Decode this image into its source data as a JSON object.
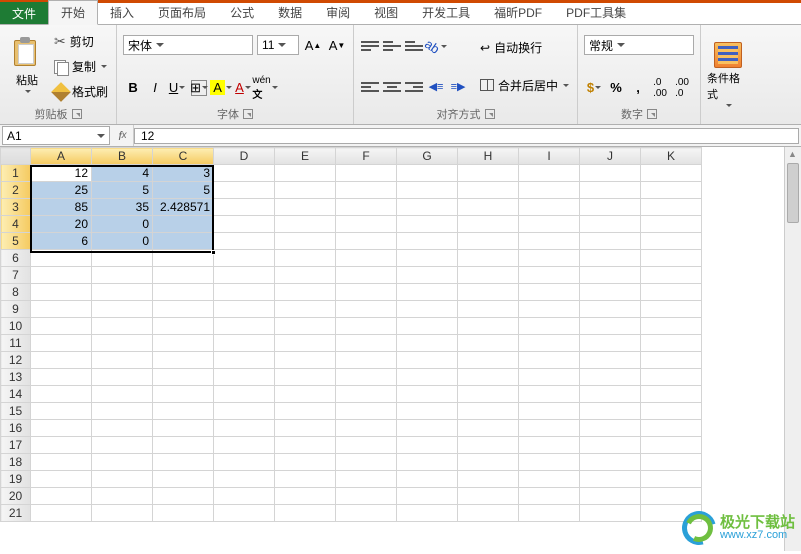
{
  "tabs": {
    "file": "文件",
    "home": "开始",
    "insert": "插入",
    "page_layout": "页面布局",
    "formulas": "公式",
    "data": "数据",
    "review": "审阅",
    "view": "视图",
    "dev": "开发工具",
    "foxit": "福昕PDF",
    "pdftools": "PDF工具集"
  },
  "ribbon": {
    "clipboard": {
      "paste": "粘贴",
      "cut": "剪切",
      "copy": "复制",
      "brush": "格式刷",
      "label": "剪贴板"
    },
    "font": {
      "name": "宋体",
      "size": "11",
      "label": "字体"
    },
    "align": {
      "wrap": "自动换行",
      "merge": "合并后居中",
      "label": "对齐方式"
    },
    "number": {
      "format": "常规",
      "label": "数字"
    },
    "cond": {
      "label": "条件格式"
    }
  },
  "namebox": "A1",
  "formula": "12",
  "columns": [
    "A",
    "B",
    "C",
    "D",
    "E",
    "F",
    "G",
    "H",
    "I",
    "J",
    "K"
  ],
  "selected_cols": [
    "A",
    "B",
    "C"
  ],
  "selected_rows": [
    1,
    2,
    3,
    4,
    5
  ],
  "cells": {
    "r1": {
      "A": "12",
      "B": "4",
      "C": "3"
    },
    "r2": {
      "A": "25",
      "B": "5",
      "C": "5"
    },
    "r3": {
      "A": "85",
      "B": "35",
      "C": "2.428571"
    },
    "r4": {
      "A": "20",
      "B": "0",
      "C": ""
    },
    "r5": {
      "A": "6",
      "B": "0",
      "C": ""
    }
  },
  "watermark": {
    "title": "极光下载站",
    "url": "www.xz7.com"
  }
}
